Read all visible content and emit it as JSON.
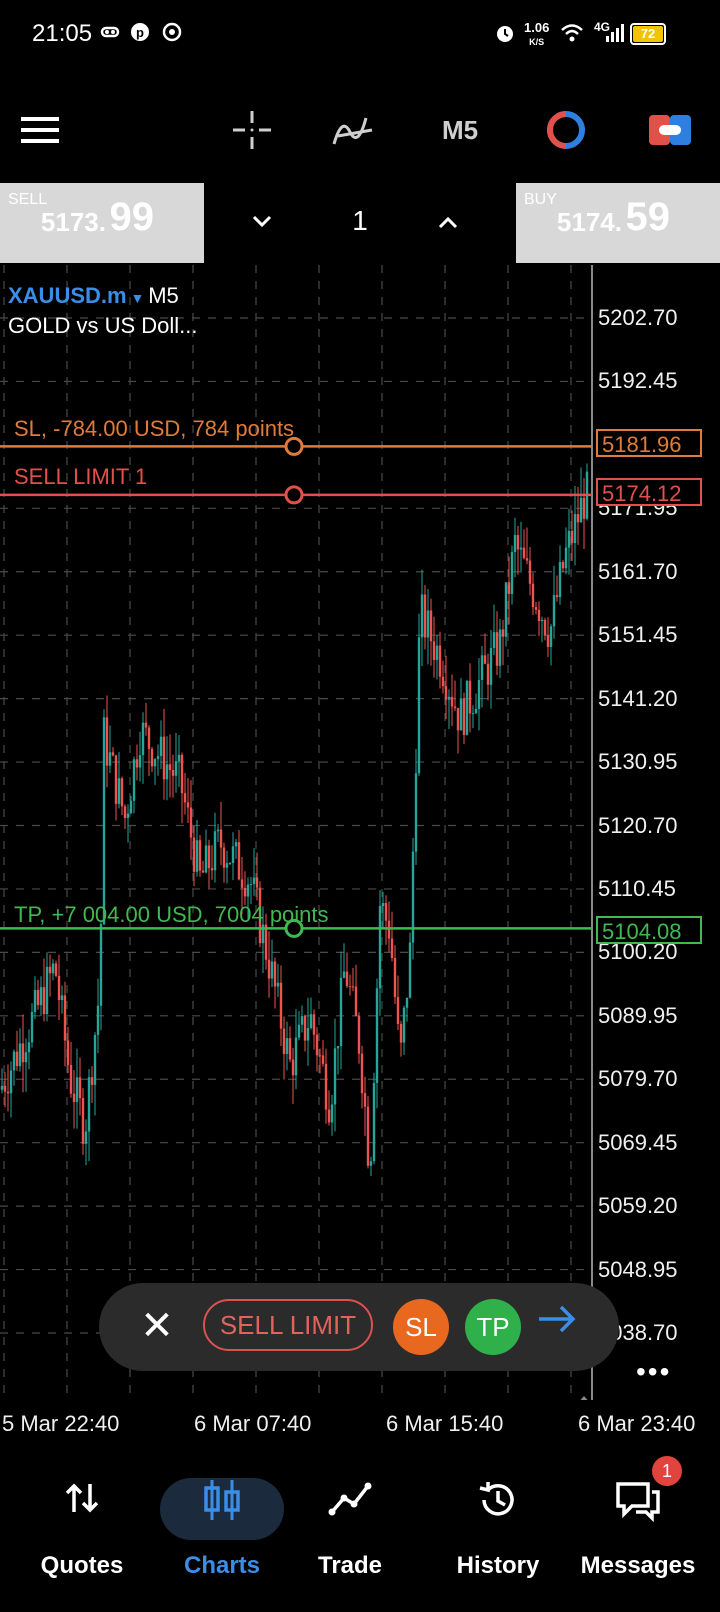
{
  "status_bar": {
    "time": "21:05",
    "net_speed_value": "1.06",
    "net_speed_unit": "K/S",
    "network": "4G",
    "battery": "72"
  },
  "toolbar": {
    "timeframe": "M5"
  },
  "trade_panel": {
    "sell": {
      "label": "SELL",
      "price_small": "5173.",
      "price_big": "99"
    },
    "buy": {
      "label": "BUY",
      "price_small": "5174.",
      "price_big": "59"
    },
    "lot": "1"
  },
  "chart": {
    "symbol": "XAUUSD.m",
    "symbol_timeframe": "M5",
    "description": "GOLD vs US Doll...",
    "price_axis": [
      "5202.70",
      "5192.45",
      "5181.96",
      "5174.12",
      "5171.95",
      "5161.70",
      "5151.45",
      "5141.20",
      "5130.95",
      "5120.70",
      "5110.45",
      "5104.08",
      "5100.20",
      "5089.95",
      "5079.70",
      "5069.45",
      "5059.20",
      "5048.95",
      "5038.70"
    ],
    "sl_line": {
      "text": "SL, -784.00 USD, 784 points",
      "price": "5181.96",
      "color": "#e07b39"
    },
    "sell_limit_line": {
      "text": "SELL LIMIT 1",
      "price": "5174.12",
      "color": "#e2504a"
    },
    "tp_line": {
      "text": "TP, +7 004.00 USD, 7004 points",
      "price": "5104.08",
      "color": "#3fb950"
    },
    "time_axis": [
      "5 Mar 22:40",
      "6 Mar 07:40",
      "6 Mar 15:40",
      "6 Mar 23:40"
    ],
    "colors": {
      "bull": "#26a69a",
      "bear": "#ef5350"
    }
  },
  "order_pill": {
    "type_label": "SELL LIMIT",
    "sl_label": "SL",
    "tp_label": "TP"
  },
  "more_label": "•••",
  "nav": {
    "items": [
      {
        "label": "Quotes",
        "icon": "quotes-arrows-icon"
      },
      {
        "label": "Charts",
        "icon": "charts-candles-icon"
      },
      {
        "label": "Trade",
        "icon": "trade-line-icon"
      },
      {
        "label": "History",
        "icon": "history-clock-icon"
      },
      {
        "label": "Messages",
        "icon": "messages-bubble-icon"
      }
    ],
    "active": "Charts",
    "messages_badge": "1"
  }
}
